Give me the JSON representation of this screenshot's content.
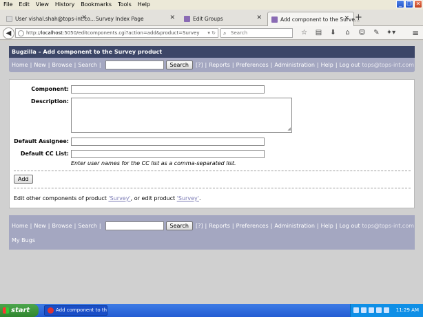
{
  "menu": [
    "File",
    "Edit",
    "View",
    "History",
    "Bookmarks",
    "Tools",
    "Help"
  ],
  "tabs": [
    {
      "title": "User vishal.shah@tops-int.co..."
    },
    {
      "title": "Survey Index Page"
    },
    {
      "title": "Edit Groups"
    },
    {
      "title": "Add component to the Surve..."
    }
  ],
  "urlbar": {
    "host": "localhost",
    "rest": ":5050/editcomponents.cgi?action=add&product=Survey"
  },
  "searchbar": {
    "placeholder": "Search"
  },
  "page": {
    "header": "Bugzilla – Add component to the Survey product",
    "nav": {
      "home": "Home",
      "new": "New",
      "browse": "Browse",
      "search": "Search",
      "search_button": "Search",
      "help_q": "[?]",
      "reports": "Reports",
      "preferences": "Preferences",
      "administration": "Administration",
      "help": "Help",
      "logout": "Log out",
      "user": "tops@tops-int.com"
    },
    "form": {
      "component_label": "Component:",
      "description_label": "Description:",
      "assignee_label": "Default Assignee:",
      "cc_label": "Default CC List:",
      "cc_hint": "Enter user names for the CC list as a comma-separated list.",
      "add_button": "Add"
    },
    "footer": {
      "t1": "Edit other components of product ",
      "link1": "'Survey'",
      "t2": ", or edit product ",
      "link2": "'Survey'",
      "t3": "."
    },
    "my_bugs": "My Bugs"
  },
  "taskbar": {
    "start": "start",
    "task": "Add component to th...",
    "clock": "11:29 AM"
  }
}
